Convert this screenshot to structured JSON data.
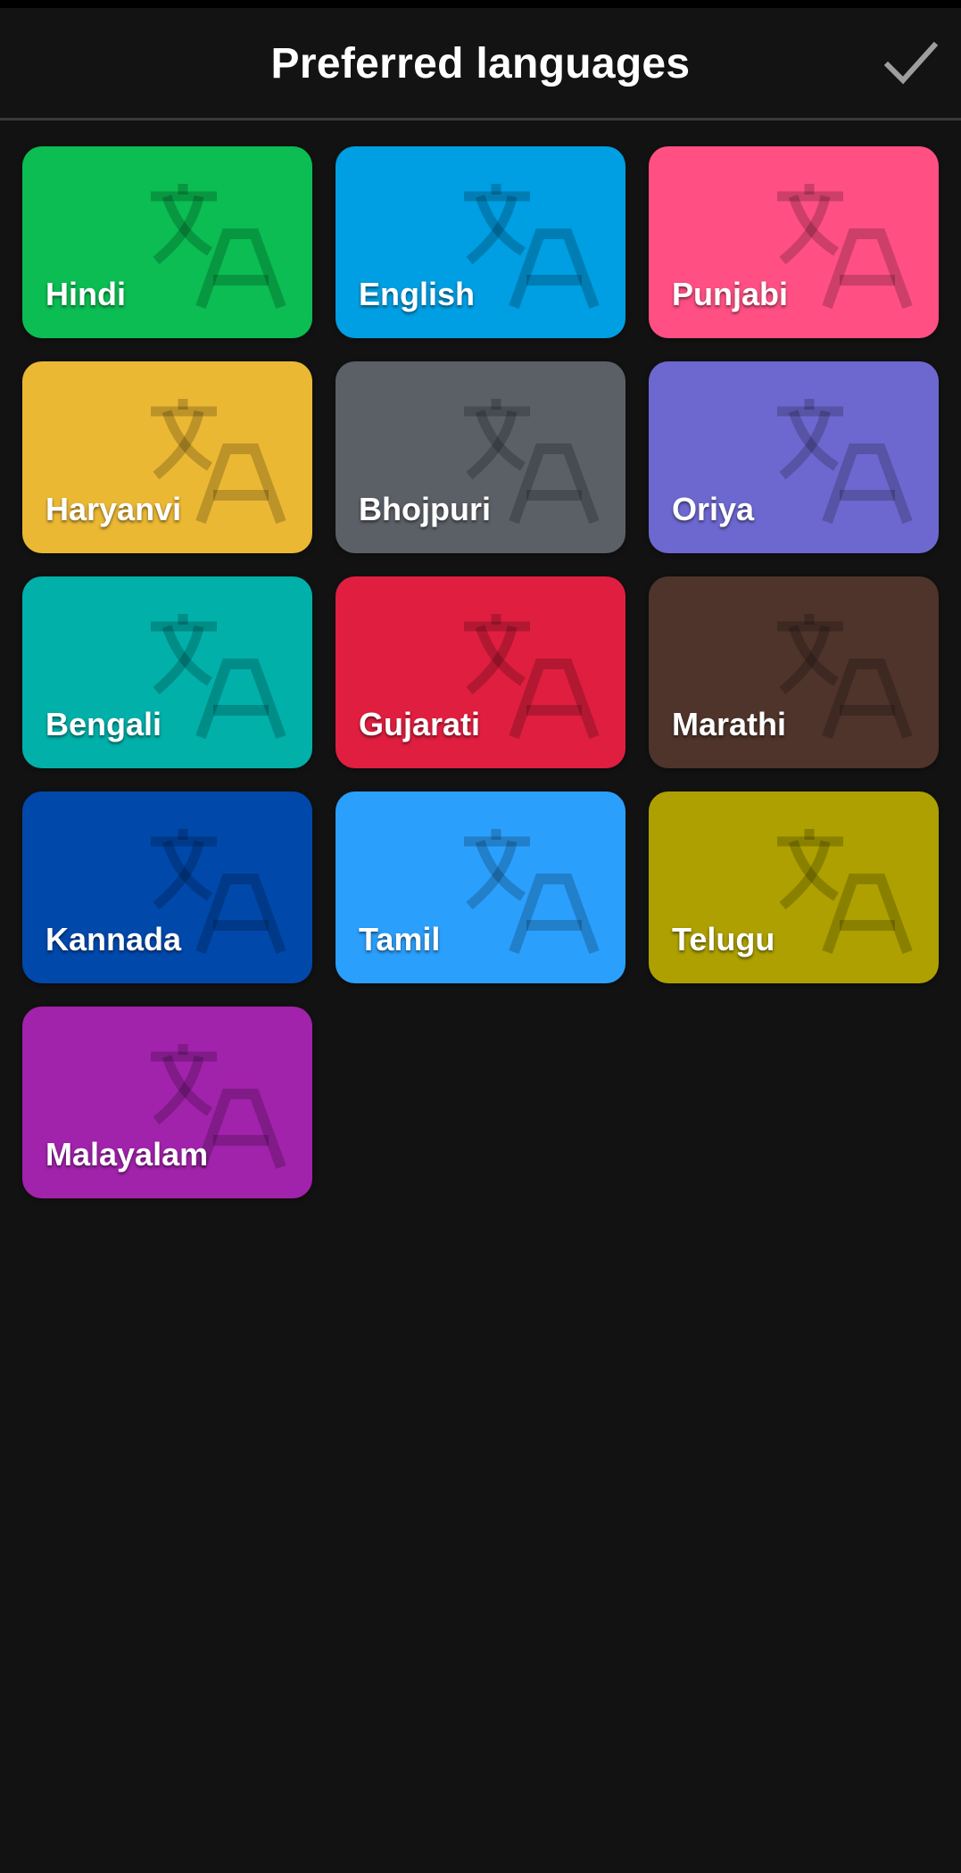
{
  "header": {
    "title": "Preferred languages",
    "done_icon": "checkmark-icon",
    "done_icon_color": "#9e9e9e"
  },
  "tile_icon": "translate-icon",
  "languages": [
    {
      "label": "Hindi",
      "color": "#0bbd52"
    },
    {
      "label": "English",
      "color": "#009ee2"
    },
    {
      "label": "Punjabi",
      "color": "#ff4f83"
    },
    {
      "label": "Haryanvi",
      "color": "#ebb834"
    },
    {
      "label": "Bhojpuri",
      "color": "#5b5f66"
    },
    {
      "label": "Oriya",
      "color": "#6d68cf"
    },
    {
      "label": "Bengali",
      "color": "#01b0a9"
    },
    {
      "label": "Gujarati",
      "color": "#e01e3f"
    },
    {
      "label": "Marathi",
      "color": "#4e342b"
    },
    {
      "label": "Kannada",
      "color": "#0148ab"
    },
    {
      "label": "Tamil",
      "color": "#2b9ffc"
    },
    {
      "label": "Telugu",
      "color": "#ada000"
    },
    {
      "label": "Malayalam",
      "color": "#a122ab"
    }
  ]
}
